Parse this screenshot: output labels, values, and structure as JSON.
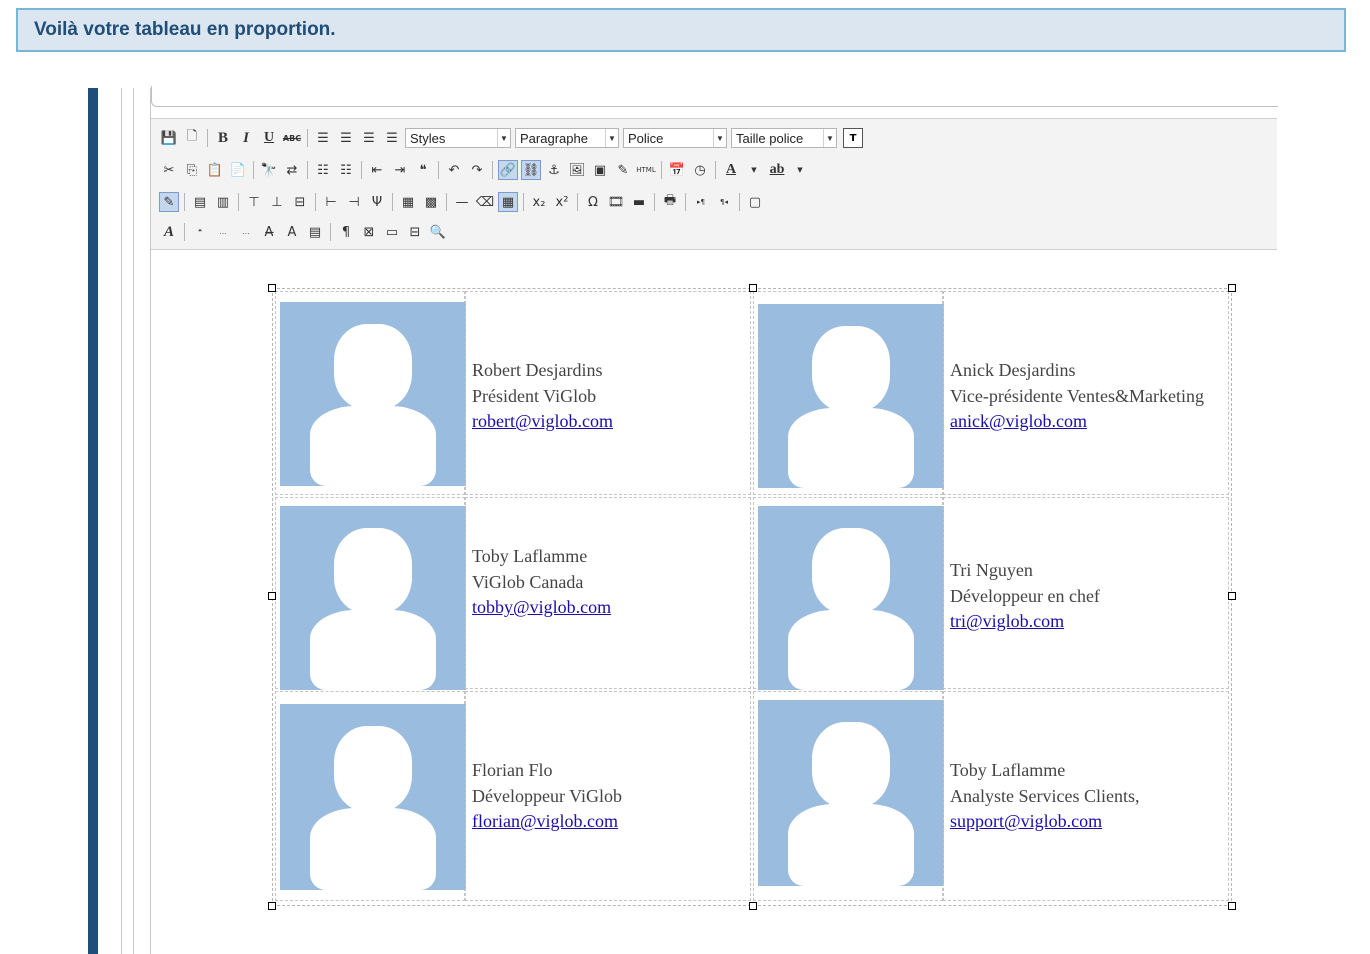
{
  "banner": {
    "text": "Voilà votre tableau en proportion."
  },
  "toolbar": {
    "styles_label": "Styles",
    "format_label": "Paragraphe",
    "font_label": "Police",
    "size_label": "Taille police",
    "html_label": "HTML",
    "t_label": "T",
    "text_color_label": "A",
    "highlight_label": "ab"
  },
  "contacts": [
    {
      "name": "Robert Desjardins",
      "title": "Président ViGlob",
      "email": "robert@viglob.com"
    },
    {
      "name": "Anick Desjardins",
      "title": "Vice-présidente Ventes&Marketing",
      "email": "anick@viglob.com"
    },
    {
      "name": "Toby Laflamme",
      "title": "ViGlob Canada",
      "email": "tobby@viglob.com"
    },
    {
      "name": "Tri Nguyen",
      "title": "Développeur en chef",
      "email": "tri@viglob.com"
    },
    {
      "name": "Florian Flo",
      "title": "Développeur ViGlob",
      "email": "florian@viglob.com"
    },
    {
      "name": "Toby Laflamme",
      "title": "Analyste Services Clients,",
      "email": "support@viglob.com"
    }
  ]
}
